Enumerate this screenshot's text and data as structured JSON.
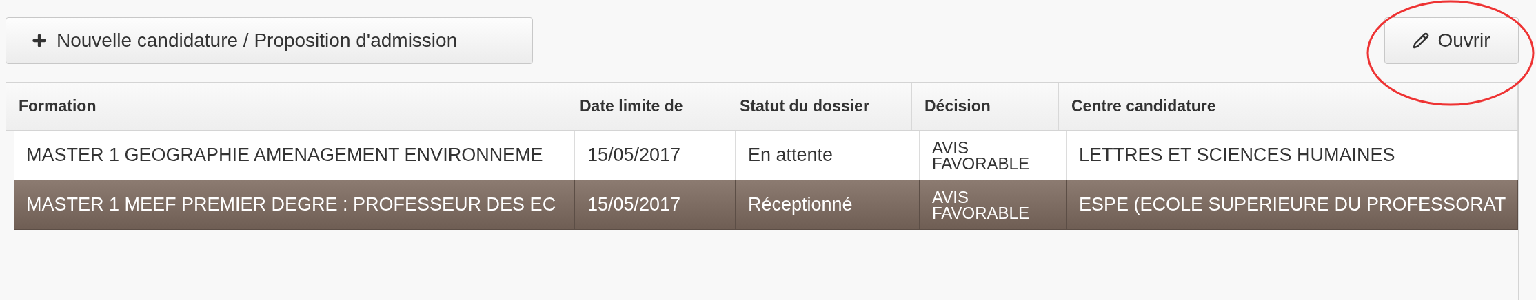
{
  "toolbar": {
    "new_button": "Nouvelle candidature / Proposition d'admission",
    "open_button": "Ouvrir",
    "open_button_circled": true
  },
  "table": {
    "columns": [
      "Formation",
      "Date limite de",
      "Statut du dossier",
      "Décision",
      "Centre candidature"
    ],
    "rows": [
      {
        "cells": [
          "MASTER 1 GEOGRAPHIE AMENAGEMENT ENVIRONNEME",
          "15/05/2017",
          "En attente",
          "AVIS FAVORABLE",
          "LETTRES ET SCIENCES HUMAINES"
        ],
        "selected": false
      },
      {
        "cells": [
          "MASTER 1 MEEF PREMIER DEGRE : PROFESSEUR DES EC",
          "15/05/2017",
          "Réceptionné",
          "AVIS FAVORABLE",
          "ESPE (ECOLE SUPERIEURE DU PROFESSORAT"
        ],
        "selected": true
      }
    ]
  }
}
